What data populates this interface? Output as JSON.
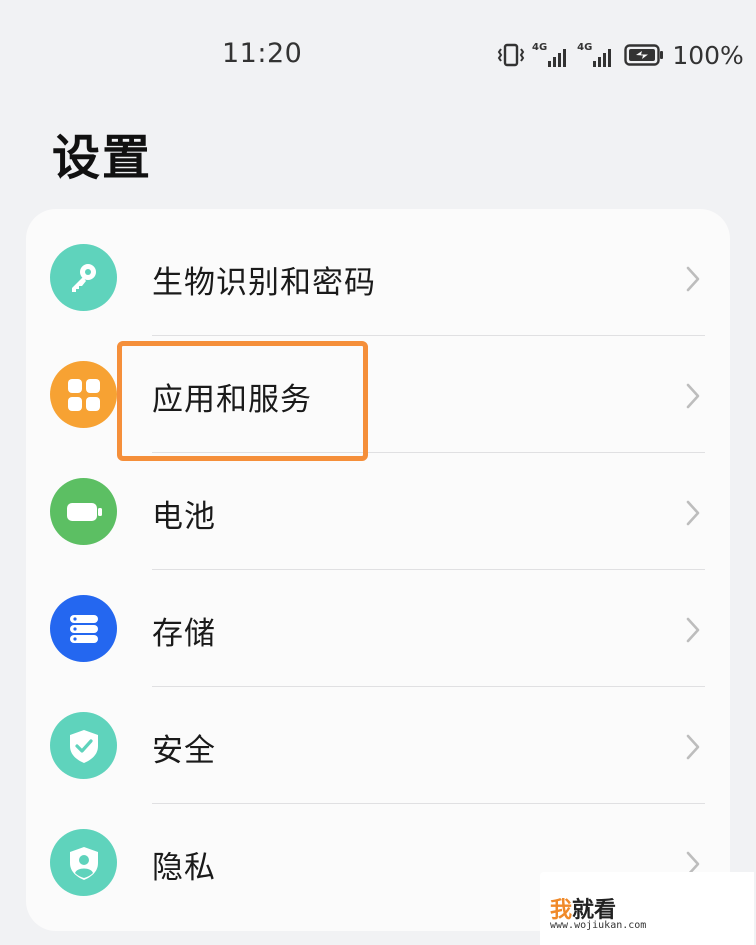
{
  "status_bar": {
    "time": "11:20",
    "network_1": "4G",
    "network_2": "4G",
    "battery_percent": "100%",
    "icons": [
      "vibrate-icon",
      "signal-4g-icon",
      "signal-4g-icon",
      "battery-charging-icon"
    ]
  },
  "page": {
    "title": "设置"
  },
  "settings": {
    "items": [
      {
        "label": "生物识别和密码",
        "icon": "key-icon",
        "icon_color": "#5fd3bc"
      },
      {
        "label": "应用和服务",
        "icon": "apps-grid-icon",
        "icon_color": "#f7a233"
      },
      {
        "label": "电池",
        "icon": "battery-icon",
        "icon_color": "#5cbf63"
      },
      {
        "label": "存储",
        "icon": "storage-icon",
        "icon_color": "#2467f0"
      },
      {
        "label": "安全",
        "icon": "shield-check-icon",
        "icon_color": "#5fd3bc"
      },
      {
        "label": "隐私",
        "icon": "privacy-shield-icon",
        "icon_color": "#5fd3bc"
      }
    ]
  },
  "annotation": {
    "highlight_color": "#f58f3a"
  },
  "watermark": {
    "text_accent": "我",
    "text_rest": "就看",
    "url": "www.wojiukan.com"
  }
}
